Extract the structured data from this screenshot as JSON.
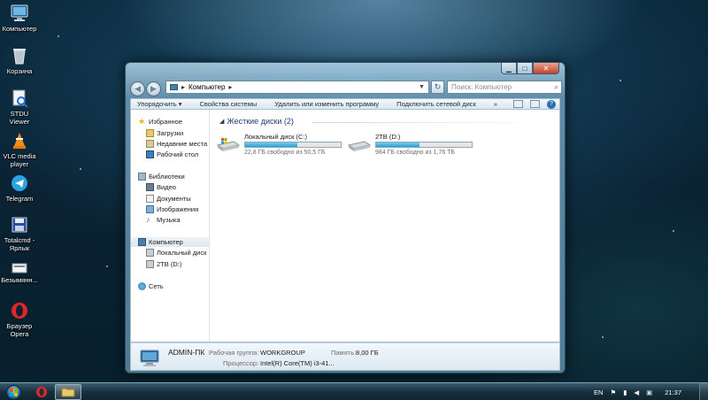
{
  "desktop": {
    "icons": [
      {
        "label": "Компьютер"
      },
      {
        "label": "Корзина"
      },
      {
        "label": "STDU Viewer"
      },
      {
        "label": "VLC media player"
      },
      {
        "label": "Telegram"
      },
      {
        "label": "Totalcmd - Ярлык"
      },
      {
        "label": "Безымянн..."
      },
      {
        "label": "Браузер Opera"
      }
    ]
  },
  "window": {
    "address": {
      "crumb": "Компьютер"
    },
    "search_placeholder": "Поиск: Компьютер",
    "toolbar": {
      "organize": "Упорядочить ▾",
      "system_properties": "Свойства системы",
      "uninstall": "Удалить или изменить программу",
      "map_drive": "Подключить сетевой диск",
      "more": "»"
    },
    "nav": {
      "favorites": "Избранное",
      "downloads": "Загрузки",
      "recent": "Недавние места",
      "desktop": "Рабочий стол",
      "libraries": "Библиотеки",
      "video": "Видео",
      "documents": "Документы",
      "pictures": "Изображения",
      "music": "Музыка",
      "computer": "Компьютер",
      "local_c": "Локальный диск (C",
      "drive_d": "2TB (D:)",
      "network": "Сеть"
    },
    "group_title": "Жесткие диски (2)",
    "drives": [
      {
        "name": "Локальный диск (C:)",
        "free": "22,8 ГБ свободно из 50,5 ГБ",
        "used_fraction": 0.55
      },
      {
        "name": "2TB (D:)",
        "free": "984 ГБ свободно из 1,76 ТБ",
        "used_fraction": 0.45
      }
    ],
    "details": {
      "pc_name": "ADMIN-ПК",
      "workgroup_label": "Рабочая группа:",
      "workgroup_value": "WORKGROUP",
      "memory_label": "Память:",
      "memory_value": "8,00 ГБ",
      "cpu_label": "Процессор:",
      "cpu_value": "Intel(R) Core(TM) i3-41..."
    }
  },
  "taskbar": {
    "language": "EN",
    "clock": "21:37"
  },
  "colors": {
    "progress": "#2aa2cf",
    "group_title": "#1e3d74"
  }
}
